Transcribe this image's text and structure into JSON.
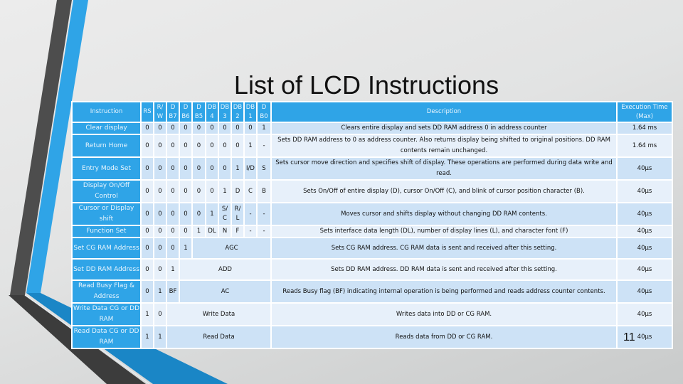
{
  "slide": {
    "title": "List of LCD Instructions",
    "page_number": "11"
  },
  "table": {
    "headers": {
      "instruction": "Instruction",
      "rs": "RS",
      "rw": "R/ W",
      "db7": "D B7",
      "db6": "D B6",
      "db5": "D B5",
      "db4": "DB 4",
      "db3": "DB 3",
      "db2": "DB 2",
      "db1": "DB 1",
      "db0": "D B0",
      "description": "Description",
      "exec_time": "Execution Time (Max)"
    },
    "rows": [
      {
        "name": "Clear display",
        "bits": [
          "0",
          "0",
          "0",
          "0",
          "0",
          "0",
          "0",
          "0",
          "0",
          "1"
        ],
        "description": "Clears entire display and sets DD RAM address 0 in address counter",
        "time": "1.64 ms"
      },
      {
        "name": "Return Home",
        "bits": [
          "0",
          "0",
          "0",
          "0",
          "0",
          "0",
          "0",
          "0",
          "1",
          "-"
        ],
        "description": "Sets DD RAM address to 0 as address counter. Also returns display being shifted to original positions. DD RAM contents remain unchanged.",
        "time": "1.64 ms"
      },
      {
        "name": "Entry Mode Set",
        "bits": [
          "0",
          "0",
          "0",
          "0",
          "0",
          "0",
          "0",
          "1",
          "I/D",
          "S"
        ],
        "description": "Sets cursor move direction and specifies shift of display. These operations are performed during data write and read.",
        "time": "40µs"
      },
      {
        "name": "Display On/Off Control",
        "bits": [
          "0",
          "0",
          "0",
          "0",
          "0",
          "0",
          "1",
          "D",
          "C",
          "B"
        ],
        "description": "Sets On/Off of entire display (D), cursor On/Off (C), and blink of cursor position character (B).",
        "time": "40µs"
      },
      {
        "name": "Cursor or Display shift",
        "bits": [
          "0",
          "0",
          "0",
          "0",
          "0",
          "1",
          "S/ C",
          "R/ L",
          "-",
          "-"
        ],
        "description": "Moves cursor and shifts display without changing DD RAM contents.",
        "time": "40µs"
      },
      {
        "name": "Function Set",
        "bits": [
          "0",
          "0",
          "0",
          "0",
          "1",
          "DL",
          "N",
          "F",
          "-",
          "-"
        ],
        "description": "Sets interface data length (DL), number of display lines (L), and character font (F)",
        "time": "40µs"
      },
      {
        "name": "Set CG RAM Address",
        "bits": [
          "0",
          "0",
          "0",
          "1"
        ],
        "merged": "AGC",
        "description": "Sets CG RAM address. CG RAM data is sent and received after this setting.",
        "time": "40µs"
      },
      {
        "name": "Set DD RAM Address",
        "bits": [
          "0",
          "0",
          "1"
        ],
        "merged": "ADD",
        "description": "Sets DD RAM address. DD RAM data is sent and received after this setting.",
        "time": "40µs"
      },
      {
        "name": "Read Busy Flag & Address",
        "bits": [
          "0",
          "1",
          "BF"
        ],
        "merged": "AC",
        "description": "Reads Busy flag (BF) indicating internal operation is being performed and reads address counter contents.",
        "time": "40µs"
      },
      {
        "name": "Write Data CG or DD RAM",
        "bits": [
          "1",
          "0"
        ],
        "merged": "Write Data",
        "description": "Writes data into DD or CG RAM.",
        "time": "40µs"
      },
      {
        "name": "Read Data CG or DD RAM",
        "bits": [
          "1",
          "1"
        ],
        "merged": "Read Data",
        "description": "Reads data from DD or CG RAM.",
        "time": "40µs"
      }
    ]
  },
  "colors": {
    "accent_blue": "#2fa4e7",
    "row_dark": "#cde2f6",
    "row_light": "#e7f0fa",
    "deco_gray": "#4a4a4a"
  }
}
